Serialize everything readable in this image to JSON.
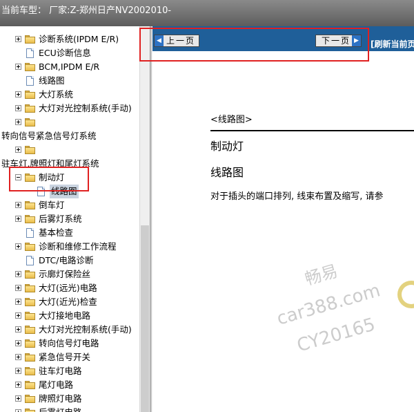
{
  "header": {
    "vehicle_label": "当前车型：  厂家:Z-郑州日产NV2002010-"
  },
  "nav": {
    "prev_label": "上一页",
    "next_label": "下一页",
    "refresh_label": "[刷新当前页"
  },
  "tree": {
    "items": [
      {
        "label": "诊断系统(IPDM E/R)",
        "icon": "folder",
        "expander": "plus"
      },
      {
        "label": "ECU诊断信息",
        "icon": "doc",
        "expander": "none"
      },
      {
        "label": "BCM,IPDM E/R",
        "icon": "folder",
        "expander": "plus"
      },
      {
        "label": "线路图",
        "icon": "doc",
        "expander": "none"
      },
      {
        "label": "大灯系统",
        "icon": "folder",
        "expander": "plus"
      },
      {
        "label": "大灯对光控制系统(手动)",
        "icon": "folder",
        "expander": "plus"
      },
      {
        "label": "",
        "icon": "folder",
        "expander": "plus"
      },
      {
        "label": "转向信号紧急信号灯系统",
        "icon": "none",
        "expander": "none"
      },
      {
        "label": "",
        "icon": "folder",
        "expander": "plus"
      },
      {
        "label": "驻车灯,牌照灯和尾灯系统",
        "icon": "none",
        "expander": "none"
      },
      {
        "label": "制动灯",
        "icon": "folder-open",
        "expander": "minus"
      },
      {
        "label": "线路图",
        "icon": "doc",
        "expander": "none",
        "selected": true
      },
      {
        "label": "倒车灯",
        "icon": "folder",
        "expander": "plus"
      },
      {
        "label": "后雾灯系统",
        "icon": "folder",
        "expander": "plus"
      },
      {
        "label": "基本检查",
        "icon": "doc",
        "expander": "none"
      },
      {
        "label": "诊断和维修工作流程",
        "icon": "folder",
        "expander": "plus"
      },
      {
        "label": "DTC/电路诊断",
        "icon": "doc",
        "expander": "none"
      },
      {
        "label": "示廓灯保险丝",
        "icon": "folder",
        "expander": "plus"
      },
      {
        "label": "大灯(远光)电路",
        "icon": "folder",
        "expander": "plus"
      },
      {
        "label": "大灯(近光)检查",
        "icon": "folder",
        "expander": "plus"
      },
      {
        "label": "大灯接地电路",
        "icon": "folder",
        "expander": "plus"
      },
      {
        "label": "大灯对光控制系统(手动)",
        "icon": "folder",
        "expander": "plus"
      },
      {
        "label": "转向信号灯电路",
        "icon": "folder",
        "expander": "plus"
      },
      {
        "label": "紧急信号开关",
        "icon": "folder",
        "expander": "plus"
      },
      {
        "label": "驻车灯电路",
        "icon": "folder",
        "expander": "plus"
      },
      {
        "label": "尾灯电路",
        "icon": "folder",
        "expander": "plus"
      },
      {
        "label": "牌照灯电路",
        "icon": "folder",
        "expander": "plus"
      },
      {
        "label": "后雾灯电路",
        "icon": "folder",
        "expander": "plus"
      }
    ]
  },
  "document": {
    "section_tag": "<线路图>",
    "title": "制动灯",
    "subtitle": "线路图",
    "paragraph": "对于插头的端口排列, 线束布置及缩写, 请参"
  },
  "watermark": {
    "line1": "畅易",
    "line2": "car388.com",
    "line3": "CY20165"
  },
  "colors": {
    "accent": "#1f5f99",
    "highlight": "#e02020"
  }
}
